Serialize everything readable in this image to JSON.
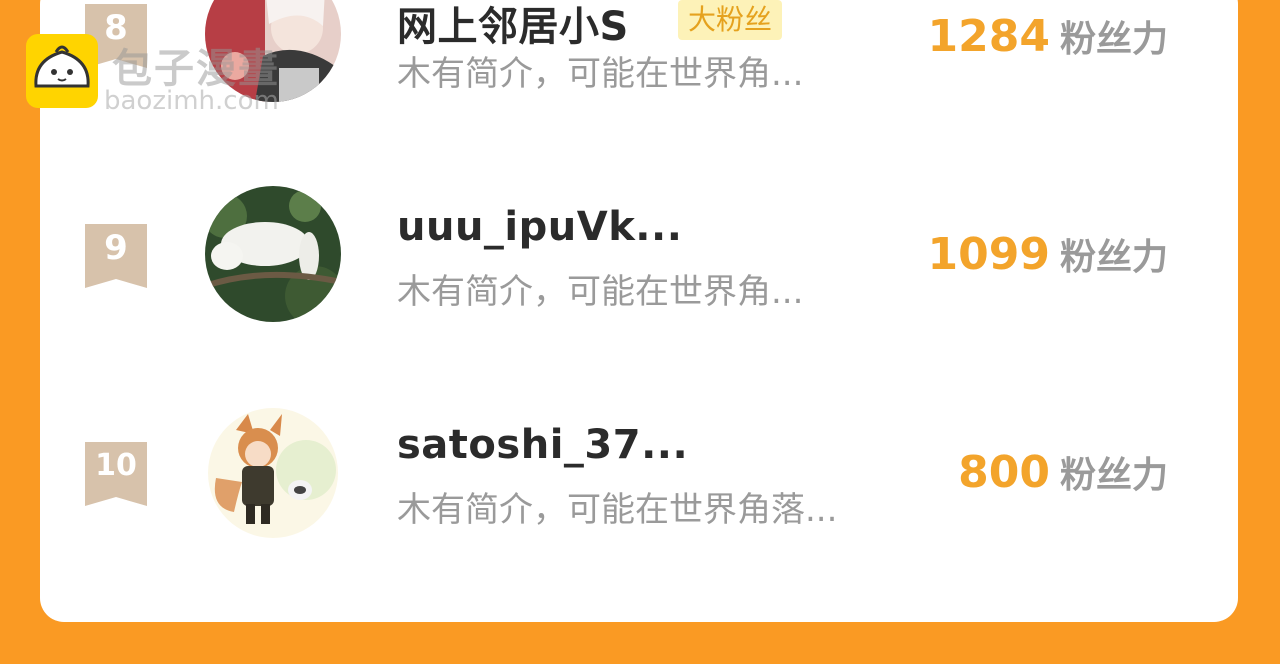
{
  "colors": {
    "background": "#FA9A23",
    "card": "#FFFFFF",
    "rank_badge": "#D7C2AB",
    "score": "#F3A42B",
    "muted_text": "#9A9A9A",
    "name_text": "#2B2B2B",
    "fan_tag_bg": "#FDF2B8",
    "fan_tag_text": "#E5A21E",
    "watermark_logo": "#FFD400"
  },
  "watermark": {
    "title": "包子漫畫",
    "domain": "baozimh.com",
    "logo_icon": "bun-face-icon"
  },
  "rows": [
    {
      "rank": "8",
      "name": "网上邻居小S",
      "tag": "大粉丝",
      "bio": "木有简介，可能在世界角...",
      "score": "1284",
      "score_unit": "粉丝力",
      "avatar_icon": "anime-character-avatar"
    },
    {
      "rank": "9",
      "name": "uuu_ipuVk...",
      "tag": "",
      "bio": "木有简介，可能在世界角...",
      "score": "1099",
      "score_unit": "粉丝力",
      "avatar_icon": "cat-in-tree-avatar"
    },
    {
      "rank": "10",
      "name": "satoshi_37...",
      "tag": "",
      "bio": "木有简介，可能在世界角落...",
      "score": "800",
      "score_unit": "粉丝力",
      "avatar_icon": "fox-boy-avatar"
    }
  ]
}
